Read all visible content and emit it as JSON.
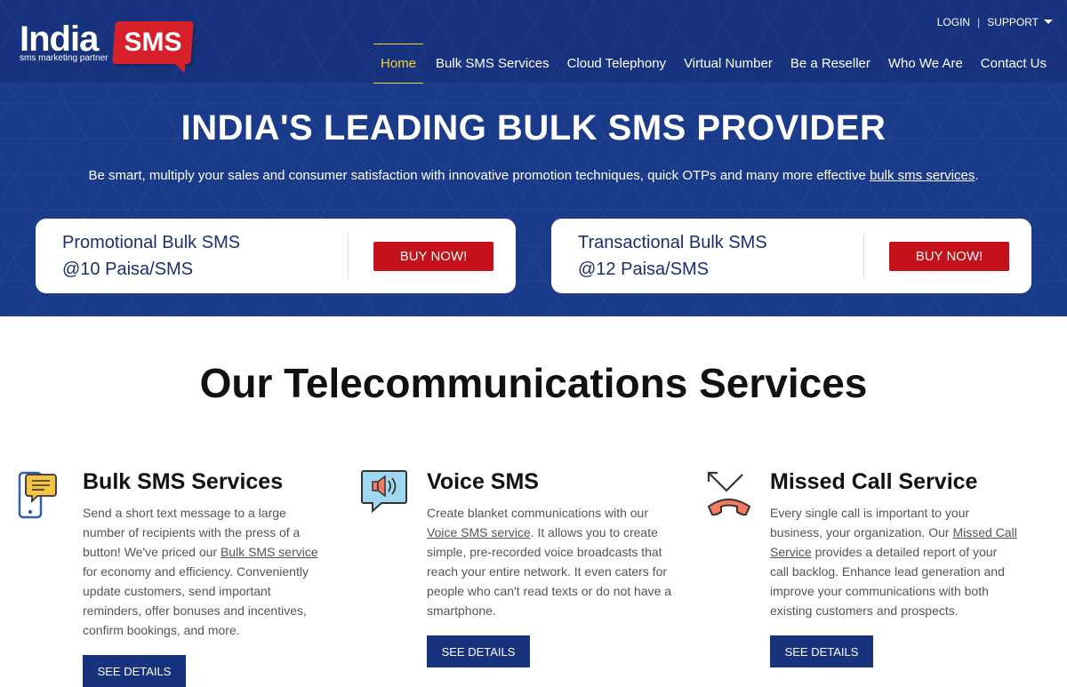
{
  "brand": {
    "name": "India",
    "badge": "SMS",
    "tagline": "sms marketing partner"
  },
  "util_nav": {
    "login": "LOGIN",
    "separator": "|",
    "support": "SUPPORT"
  },
  "main_nav": [
    {
      "label": "Home",
      "active": true
    },
    {
      "label": "Bulk SMS Services"
    },
    {
      "label": "Cloud Telephony"
    },
    {
      "label": "Virtual Number"
    },
    {
      "label": "Be a Reseller"
    },
    {
      "label": "Who We Are"
    },
    {
      "label": "Contact Us"
    }
  ],
  "hero": {
    "title": "INDIA'S LEADING BULK SMS PROVIDER",
    "subtitle_pre": "Be smart, multiply your sales and consumer satisfaction with innovative promotion techniques, quick OTPs and many more effective ",
    "subtitle_link": "bulk sms services",
    "subtitle_post": "."
  },
  "pricing": [
    {
      "title": "Promotional Bulk SMS",
      "price": "@10 Paisa/SMS",
      "button": "BUY NOW!"
    },
    {
      "title": "Transactional Bulk SMS",
      "price": "@12 Paisa/SMS",
      "button": "BUY NOW!"
    }
  ],
  "services": {
    "title": "Our Telecommunications Services",
    "items": [
      {
        "heading": "Bulk SMS Services",
        "text_pre": "Send a short text message to a large number of recipients with the press of a button! We've priced our ",
        "text_link": "Bulk SMS service",
        "text_post": " for economy and efficiency. Conveniently update customers, send important reminders, offer bonuses and incentives, confirm bookings, and more.",
        "button": "SEE DETAILS"
      },
      {
        "heading": "Voice SMS",
        "text_pre": "Create blanket communications with our ",
        "text_link": "Voice SMS service",
        "text_post": ". It allows you to create simple, pre-recorded voice broadcasts that reach your entire network. It even caters for people who can't read texts or do not have a smartphone.",
        "button": "SEE DETAILS"
      },
      {
        "heading": "Missed Call Service",
        "text_pre": "Every single call is important to your business, your organization. Our ",
        "text_link": "Missed Call Service",
        "text_post": " provides a detailed report of your call backlog. Enhance lead generation and improve your communications with both existing customers and prospects.",
        "button": "SEE DETAILS"
      }
    ]
  },
  "colors": {
    "brand_blue": "#17337e",
    "accent_red": "#c4111b",
    "active_yellow": "#f5d33b"
  }
}
